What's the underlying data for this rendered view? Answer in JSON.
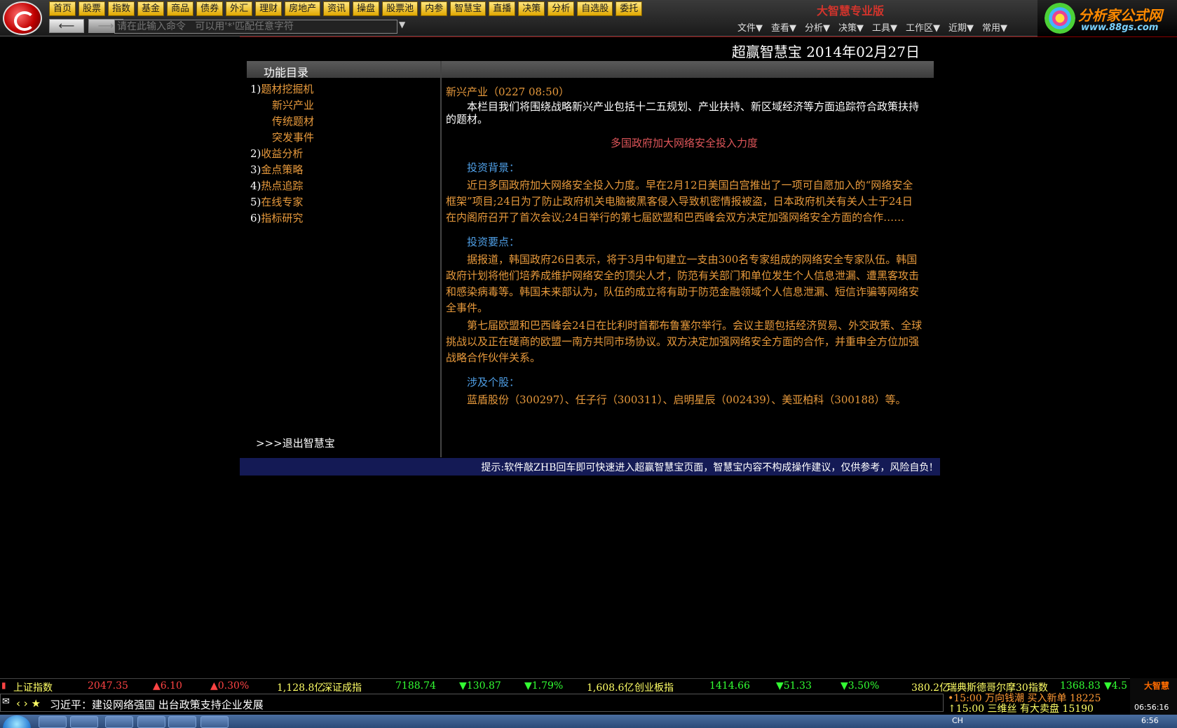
{
  "toolbar": {
    "nav": [
      "首页",
      "股票",
      "指数",
      "基金",
      "商品",
      "债券",
      "外汇",
      "理财",
      "房地产",
      "资讯",
      "操盘",
      "股票池",
      "内参",
      "智慧宝",
      "直播",
      "决策",
      "分析",
      "自选股",
      "委托"
    ],
    "brand_title": "大智慧专业版",
    "back_label": "⟵",
    "forward_label": "⟶",
    "command_placeholder": "请在此输入命令   可以用'*'匹配任意字符",
    "menu": [
      "文件▼",
      "查看▼",
      "分析▼",
      "决策▼",
      "工具▼",
      "工作区▼",
      "近期▼",
      "常用▼"
    ]
  },
  "corner_logo": {
    "title": "分析家公式网",
    "url": "www.88gs.com"
  },
  "page": {
    "header": "超赢智慧宝  2014年02月27日",
    "panel_title": "功能目录",
    "exit_link": ">>>退出智慧宝",
    "tip": "提示:软件敲ZHB回车即可快速进入超赢智慧宝页面，智慧宝内容不构成操作建议，仅供参考，风险自负!"
  },
  "sidebar": {
    "items": [
      {
        "num": "1)",
        "label": "题材挖掘机"
      },
      {
        "num": "2)",
        "label": "收益分析"
      },
      {
        "num": "3)",
        "label": "金点策略"
      },
      {
        "num": "4)",
        "label": "热点追踪"
      },
      {
        "num": "5)",
        "label": "在线专家"
      },
      {
        "num": "6)",
        "label": "指标研究"
      }
    ],
    "subitems": [
      "新兴产业",
      "传统题材",
      "突发事件"
    ]
  },
  "content": {
    "title": "新兴产业（0227 08:50）",
    "intro": "本栏目我们将围绕战略新兴产业包括十二五规划、产业扶持、新区域经济等方面追踪符合政策扶持的题材。",
    "headline": "多国政府加大网络安全投入力度",
    "sec1": "投资背景：",
    "p1": "近日多国政府加大网络安全投入力度。早在2月12日美国白宫推出了一项可自愿加入的“网络安全框架”项目;24日为了防止政府机关电脑被黑客侵入导致机密情报被盗，日本政府机关有关人士于24日在内阁府召开了首次会议;24日举行的第七届欧盟和巴西峰会双方决定加强网络安全方面的合作……",
    "sec2": "投资要点：",
    "p2": "据报道，韩国政府26日表示，将于3月中旬建立一支由300名专家组成的网络安全专家队伍。韩国政府计划将他们培养成维护网络安全的顶尖人才，防范有关部门和单位发生个人信息泄漏、遭黑客攻击和感染病毒等。韩国未来部认为，队伍的成立将有助于防范金融领域个人信息泄漏、短信诈骗等网络安全事件。",
    "p3": "第七届欧盟和巴西峰会24日在比利时首都布鲁塞尔举行。会议主题包括经济贸易、外交政策、全球挑战以及正在磋商的欧盟一南方共同市场协议。双方决定加强网络安全方面的合作，并重申全方位加强战略合作伙伴关系。",
    "sec3": "涉及个股：",
    "p4": "蓝盾股份（300297）、任子行（300311）、启明星辰（002439）、美亚柏科（300188）等。"
  },
  "ticker": {
    "sh_name": "上证指数",
    "sh_price": "2047.35",
    "sh_chg": "▲6.10",
    "sh_pct": "▲0.30%",
    "sh_vol": "1,128.8亿",
    "sz_name": "深证成指",
    "sz_price": "7188.74",
    "sz_chg": "▼130.87",
    "sz_pct": "▼1.79%",
    "sz_vol": "1,608.6亿",
    "cy_name": "创业板指",
    "cy_price": "1414.66",
    "cy_chg": "▼51.33",
    "cy_pct": "▼3.50%",
    "cy_vol": "380.2亿",
    "omx_name": "瑞典斯德哥尔摩30指数",
    "omx_price": "1368.83",
    "omx_chg": "▼4.5"
  },
  "news": {
    "text": "习近平：建设网络强国 出台政策支持企业发展",
    "rt1": "•15:00 万向钱潮 买入新单 18225",
    "rt2": "↑15:00 三维丝   有大卖盘 15190"
  },
  "clock": {
    "brand": "大智慧",
    "time": "06:56:16"
  },
  "tray": {
    "lang": "CH",
    "time": "6:56"
  },
  "colors": {
    "accent_orange": "#e89a3c",
    "section_blue": "#4f9fe6",
    "headline_red": "#e0565a",
    "tip_bg": "#141a55"
  }
}
